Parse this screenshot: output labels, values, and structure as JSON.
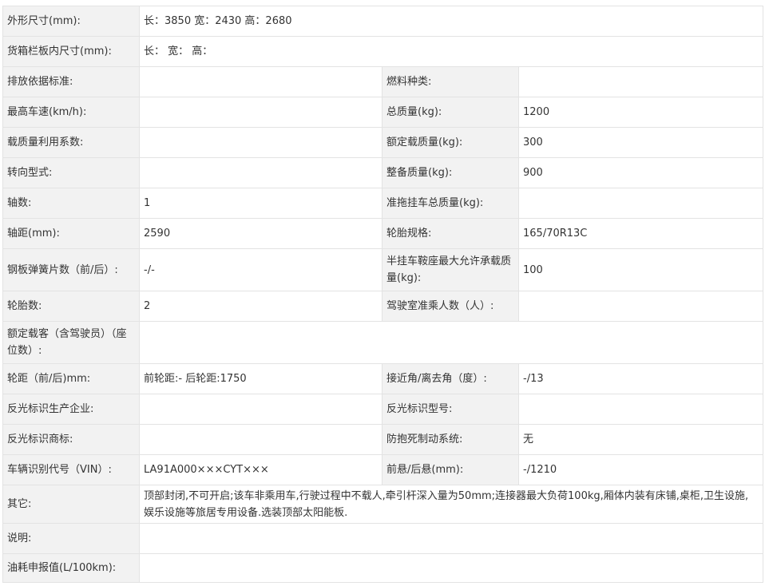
{
  "rows": [
    {
      "type": "wide",
      "label": "外形尺寸(mm):",
      "value": "长：3850 宽：2430 高：2680"
    },
    {
      "type": "wide",
      "label": "货箱栏板内尺寸(mm):",
      "value": "长：  宽：  高："
    },
    {
      "type": "pair",
      "label1": "排放依据标准:",
      "value1": "",
      "label2": "燃料种类:",
      "value2": ""
    },
    {
      "type": "pair",
      "label1": "最高车速(km/h):",
      "value1": "",
      "label2": "总质量(kg):",
      "value2": "1200"
    },
    {
      "type": "pair",
      "label1": "载质量利用系数:",
      "value1": "",
      "label2": "额定载质量(kg):",
      "value2": "300"
    },
    {
      "type": "pair",
      "label1": "转向型式:",
      "value1": "",
      "label2": "整备质量(kg):",
      "value2": "900"
    },
    {
      "type": "pair",
      "label1": "轴数:",
      "value1": "1",
      "label2": "准拖挂车总质量(kg):",
      "value2": ""
    },
    {
      "type": "pair",
      "label1": "轴距(mm):",
      "value1": "2590",
      "label2": "轮胎规格:",
      "value2": "165/70R13C"
    },
    {
      "type": "pair",
      "label1": "钢板弹簧片数（前/后）:",
      "value1": "-/-",
      "label2": "半挂车鞍座最大允许承载质量(kg):",
      "value2": "100"
    },
    {
      "type": "pair",
      "label1": "轮胎数:",
      "value1": "2",
      "label2": "驾驶室准乘人数（人）:",
      "value2": ""
    },
    {
      "type": "wide",
      "label": "额定载客（含驾驶员）（座位数）:",
      "value": ""
    },
    {
      "type": "pair",
      "label1": "轮距（前/后)mm:",
      "value1": "前轮距:- 后轮距:1750",
      "label2": "接近角/离去角（度）:",
      "value2": "-/13"
    },
    {
      "type": "pair",
      "label1": "反光标识生产企业:",
      "value1": "",
      "label2": "反光标识型号:",
      "value2": ""
    },
    {
      "type": "pair",
      "label1": "反光标识商标:",
      "value1": "",
      "label2": "防抱死制动系统:",
      "value2": "无"
    },
    {
      "type": "pair",
      "label1": "车辆识别代号（VIN）:",
      "value1": "LA91A000×××CYT×××",
      "label2": "前悬/后悬(mm):",
      "value2": "-/1210"
    },
    {
      "type": "wide",
      "label": "其它:",
      "value": "顶部封闭,不可开启;该车非乘用车,行驶过程中不载人,牵引杆深入量为50mm;连接器最大负荷100kg,厢体内装有床铺,桌柜,卫生设施,娱乐设施等旅居专用设备.选装顶部太阳能板."
    },
    {
      "type": "wide",
      "label": "说明:",
      "value": ""
    },
    {
      "type": "wide",
      "label": "油耗申报值(L/100km):",
      "value": ""
    }
  ]
}
